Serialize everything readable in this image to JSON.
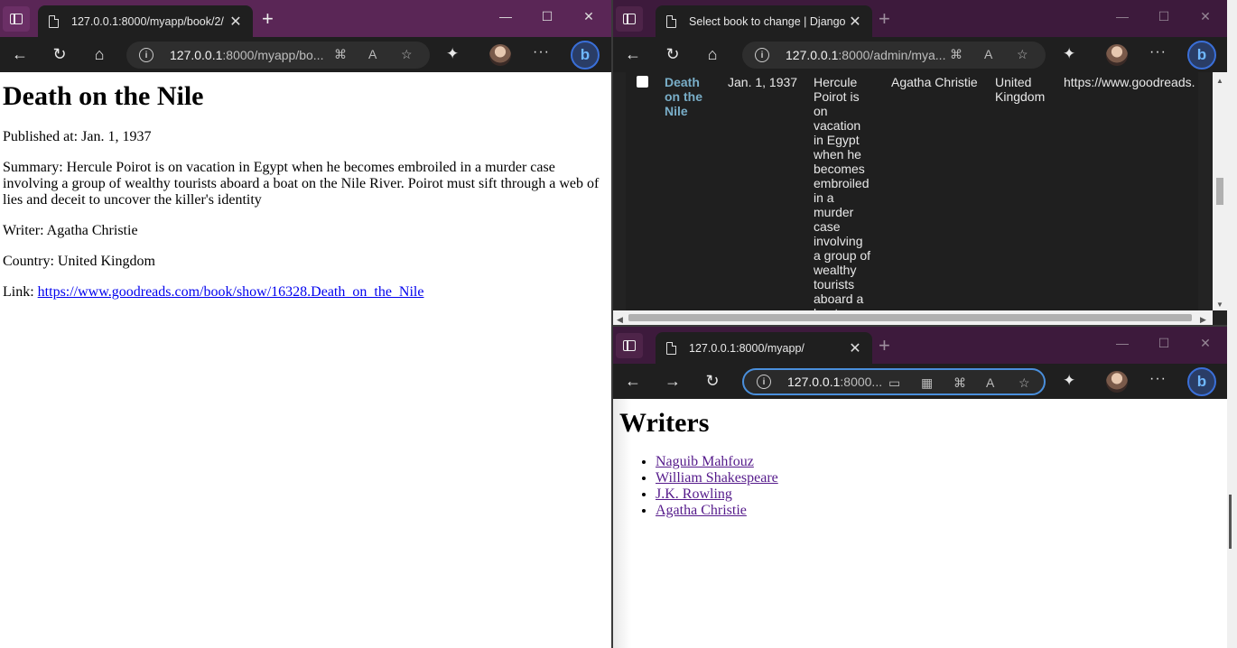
{
  "window_left": {
    "tab_title": "127.0.0.1:8000/myapp/book/2/",
    "address": {
      "host": "127.0.0.1",
      "rest": ":8000/myapp/bo..."
    },
    "book": {
      "title": "Death on the Nile",
      "published": "Published at: Jan. 1, 1937",
      "summary": "Summary: Hercule Poirot is on vacation in Egypt when he becomes embroiled in a murder case involving a group of wealthy tourists aboard a boat on the Nile River. Poirot must sift through a web of lies and deceit to uncover the killer's identity",
      "writer": "Writer: Agatha Christie",
      "country": "Country: United Kingdom",
      "link_label": "Link: ",
      "link": "https://www.goodreads.com/book/show/16328.Death_on_the_Nile"
    }
  },
  "window_top_right": {
    "tab_title": "Select book to change | Django s",
    "address": {
      "host": "127.0.0.1",
      "rest": ":8000/admin/mya..."
    },
    "row": {
      "title_lines": [
        "Death",
        "on the",
        "Nile"
      ],
      "date": "Jan. 1, 1937",
      "summary_lines": [
        "Hercule",
        "Poirot is",
        "on",
        "vacation",
        "in Egypt",
        "when he",
        "becomes",
        "embroiled",
        "in a",
        "murder",
        "case",
        "involving",
        "a group of",
        "wealthy",
        "tourists",
        "aboard a",
        "boat"
      ],
      "writer": "Agatha Christie",
      "country_lines": [
        "United",
        "Kingdom"
      ],
      "link": "https://www.goodreads."
    }
  },
  "window_bottom_right": {
    "tab_title": "127.0.0.1:8000/myapp/",
    "address": {
      "host": "127.0.0.1",
      "rest": ":8000..."
    },
    "heading": "Writers",
    "writers": [
      "Naguib Mahfouz",
      "William Shakespeare",
      "J.K. Rowling",
      "Agatha Christie"
    ]
  },
  "icons": {
    "back": "←",
    "forward": "→",
    "refresh": "↻",
    "home": "⌂",
    "more": "···",
    "close": "✕",
    "minimize": "—",
    "maximize": "☐",
    "new_tab": "+",
    "info": "i",
    "extensions": "✦",
    "bing": "b"
  },
  "colors": {
    "titlebar": "#5a2656",
    "toolbar": "#1f1f1f",
    "link": "#0000ee",
    "visited": "#551a8b",
    "admin_link": "#79aec8"
  }
}
